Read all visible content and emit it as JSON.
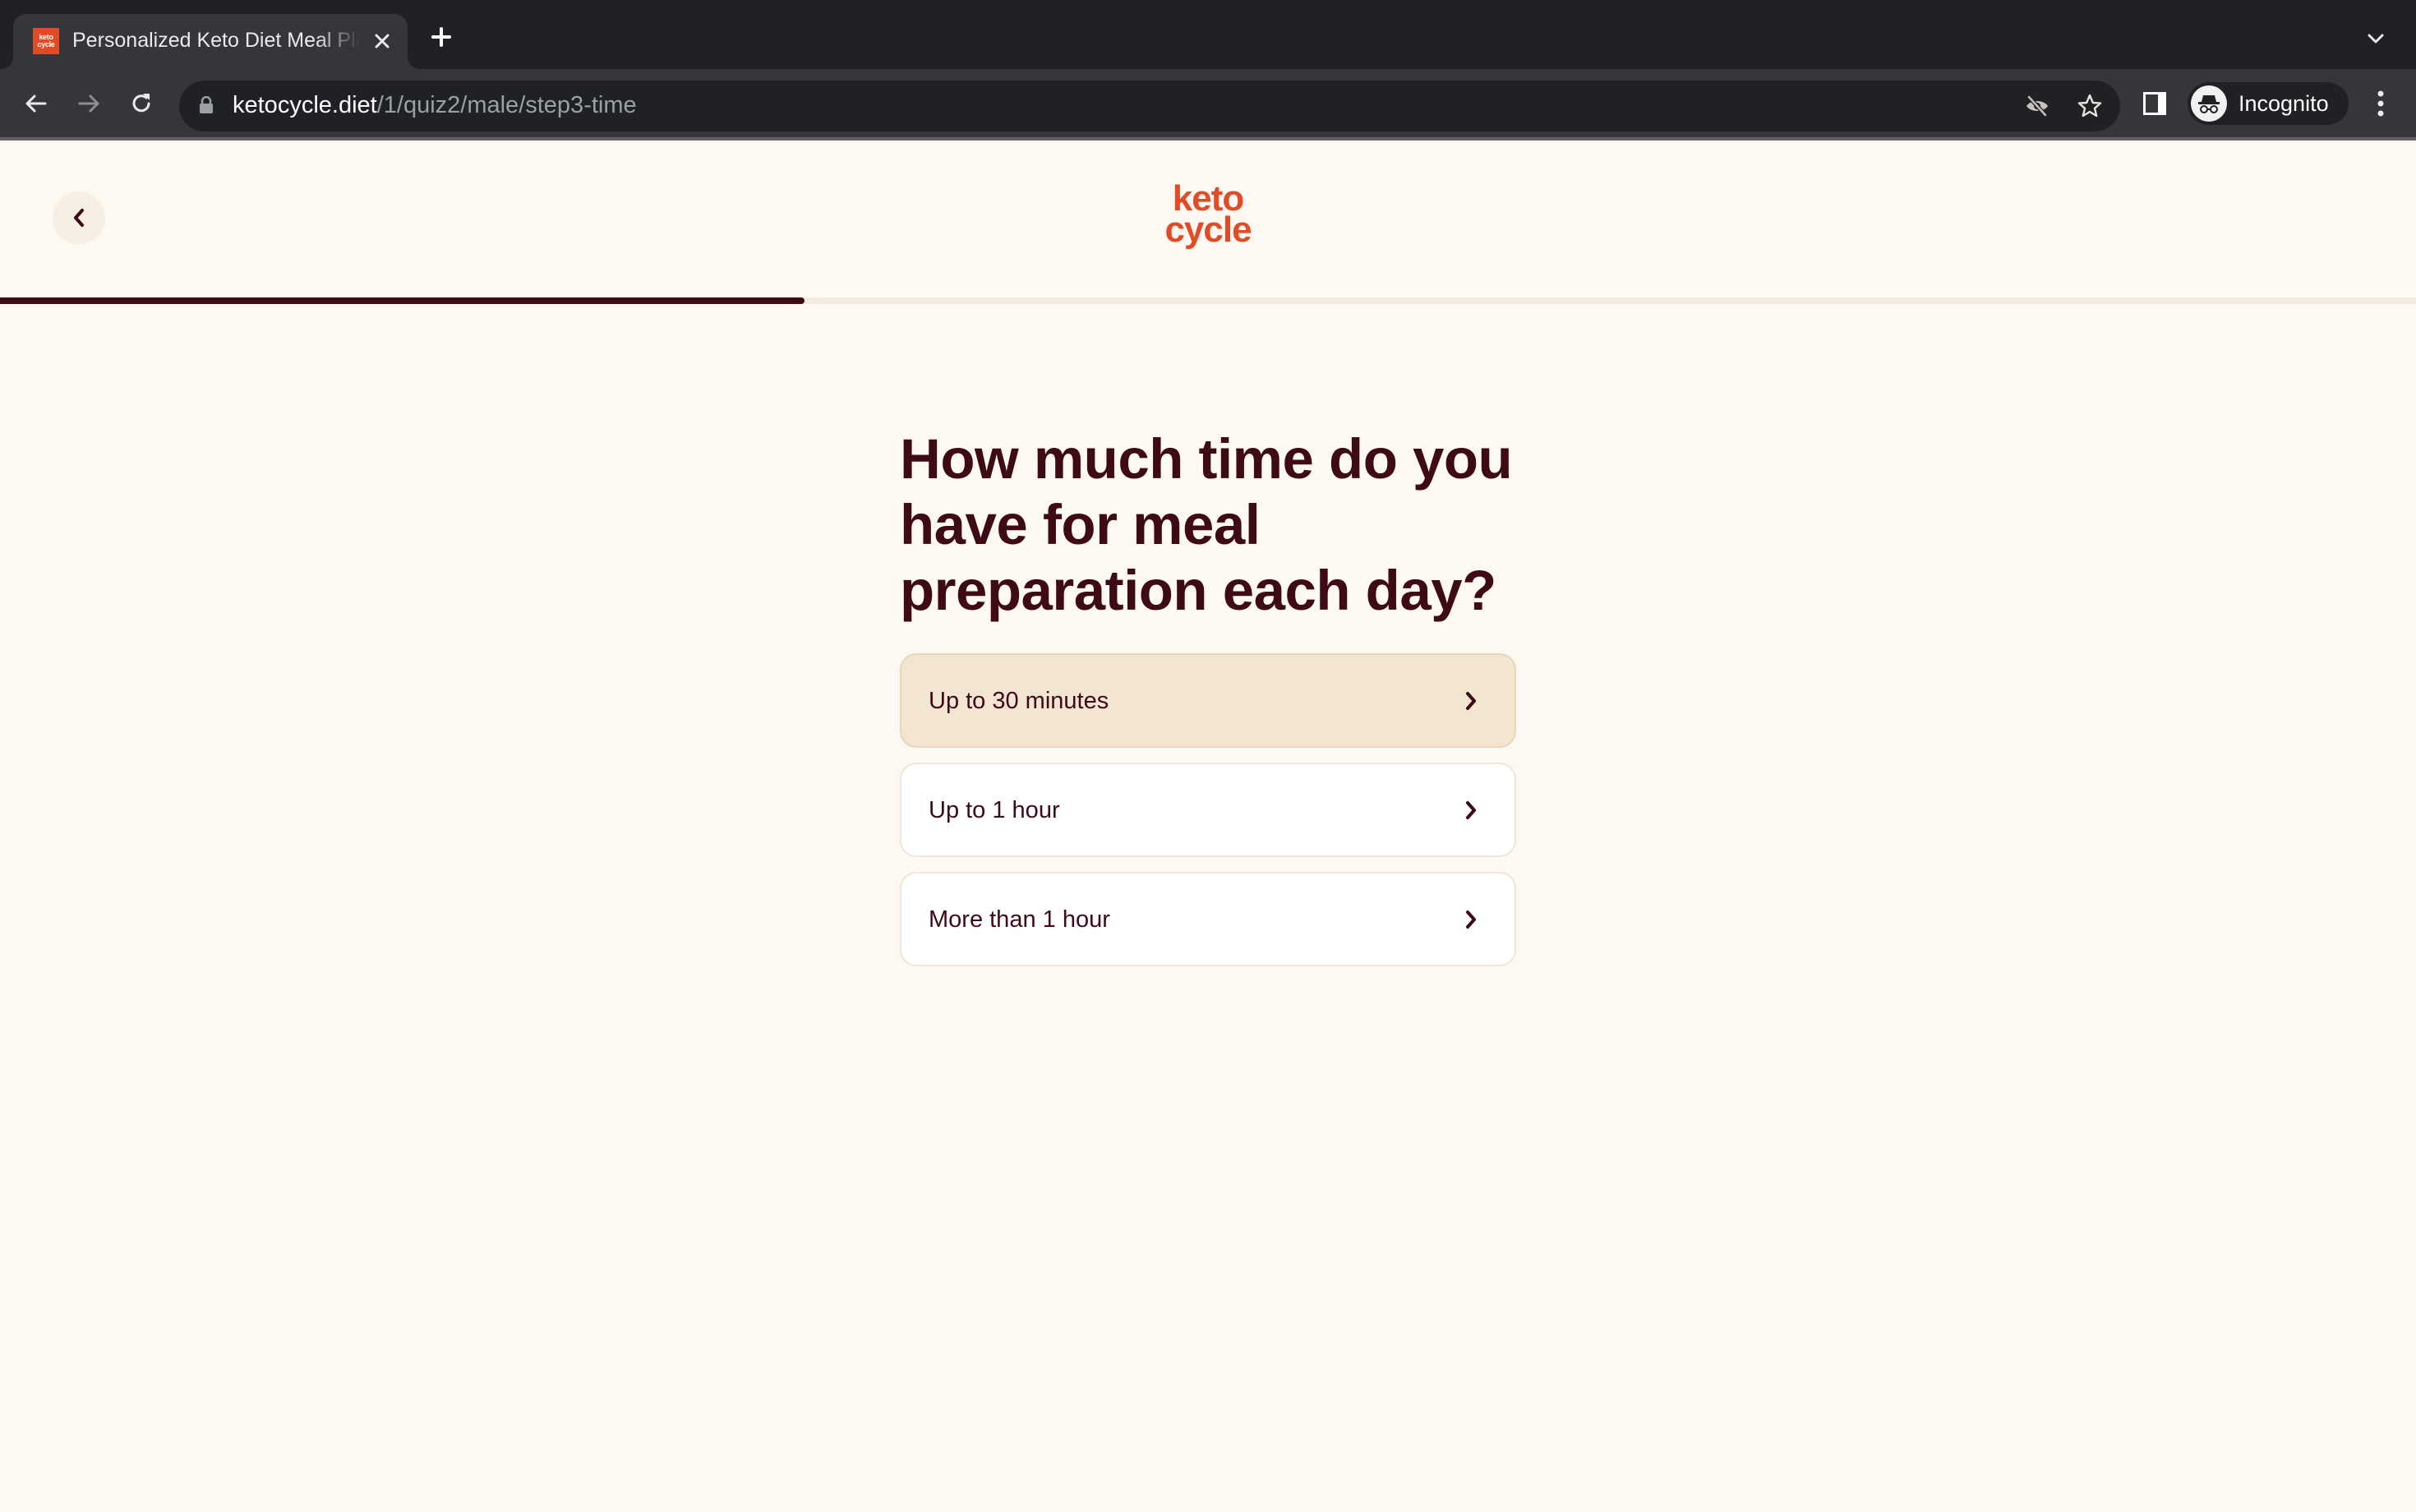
{
  "browser": {
    "tab": {
      "title": "Personalized Keto Diet Meal Plan",
      "favicon_text_line1": "keto",
      "favicon_text_line2": "cycle",
      "favicon_color": "#e14b25"
    },
    "new_tab_icon": "plus-icon",
    "address": {
      "host": "ketocycle.diet",
      "path": "/1/quiz2/male/step3-time"
    },
    "profile_label": "Incognito",
    "icons": [
      "back-arrow-icon",
      "forward-arrow-icon",
      "reload-icon",
      "lock-icon",
      "eye-off-icon",
      "star-icon",
      "side-panel-icon",
      "incognito-icon",
      "kebab-menu-icon",
      "tab-list-chevron-icon"
    ]
  },
  "page": {
    "logo": {
      "line1": "keto",
      "line2": "cycle",
      "color": "#e14b25"
    },
    "progress": {
      "fraction": 0.333,
      "fill_color": "#3d0a16",
      "track_color": "#f3ece0"
    },
    "question": "How much time do you have for meal preparation each day?",
    "options": [
      {
        "label": "Up to 30 minutes",
        "selected": true
      },
      {
        "label": "Up to 1 hour",
        "selected": false
      },
      {
        "label": "More than 1 hour",
        "selected": false
      }
    ],
    "colors": {
      "text": "#3d0a16",
      "background": "#fdf9f2",
      "selected_option_bg": "#f2e6d3",
      "option_bg": "#ffffff"
    }
  }
}
